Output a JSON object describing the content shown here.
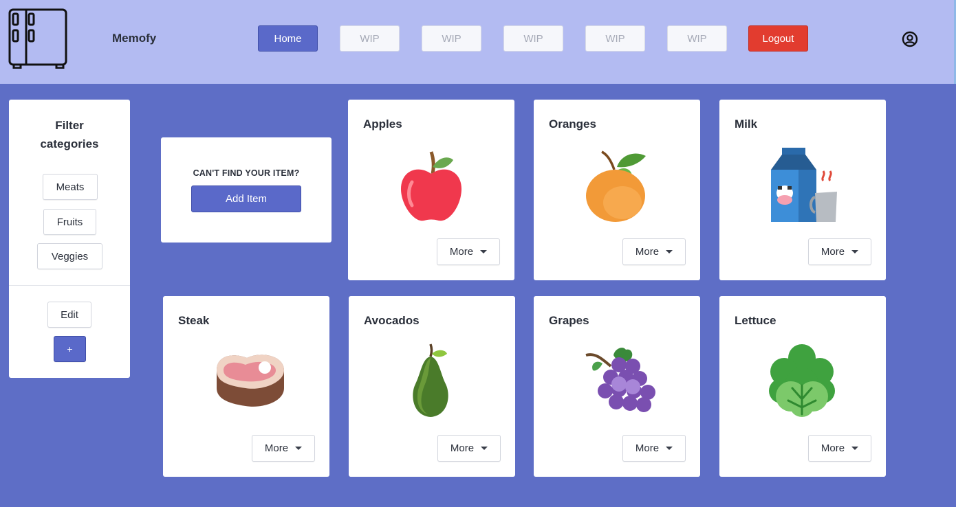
{
  "header": {
    "brand": "Memofy",
    "nav": [
      "Home",
      "WIP",
      "WIP",
      "WIP",
      "WIP",
      "WIP"
    ],
    "logout": "Logout",
    "logo_icon": "fridge-icon",
    "profile_icon": "user-circle-icon"
  },
  "sidebar": {
    "title": "Filter categories",
    "categories": [
      "Meats",
      "Fruits",
      "Veggies"
    ],
    "edit": "Edit",
    "add": "+"
  },
  "add_card": {
    "question": "CAN'T FIND YOUR ITEM?",
    "button": "Add Item"
  },
  "items": [
    {
      "name": "Apples",
      "icon": "apple-icon",
      "more": "More"
    },
    {
      "name": "Oranges",
      "icon": "orange-icon",
      "more": "More"
    },
    {
      "name": "Milk",
      "icon": "milk-icon",
      "more": "More"
    },
    {
      "name": "Steak",
      "icon": "steak-icon",
      "more": "More"
    },
    {
      "name": "Avocados",
      "icon": "avocado-icon",
      "more": "More"
    },
    {
      "name": "Grapes",
      "icon": "grapes-icon",
      "more": "More"
    },
    {
      "name": "Lettuce",
      "icon": "lettuce-icon",
      "more": "More"
    }
  ],
  "colors": {
    "header_bg": "#b3bbf2",
    "page_bg": "#5e6ec6",
    "primary": "#5a69c9",
    "logout": "#e23c2f"
  }
}
